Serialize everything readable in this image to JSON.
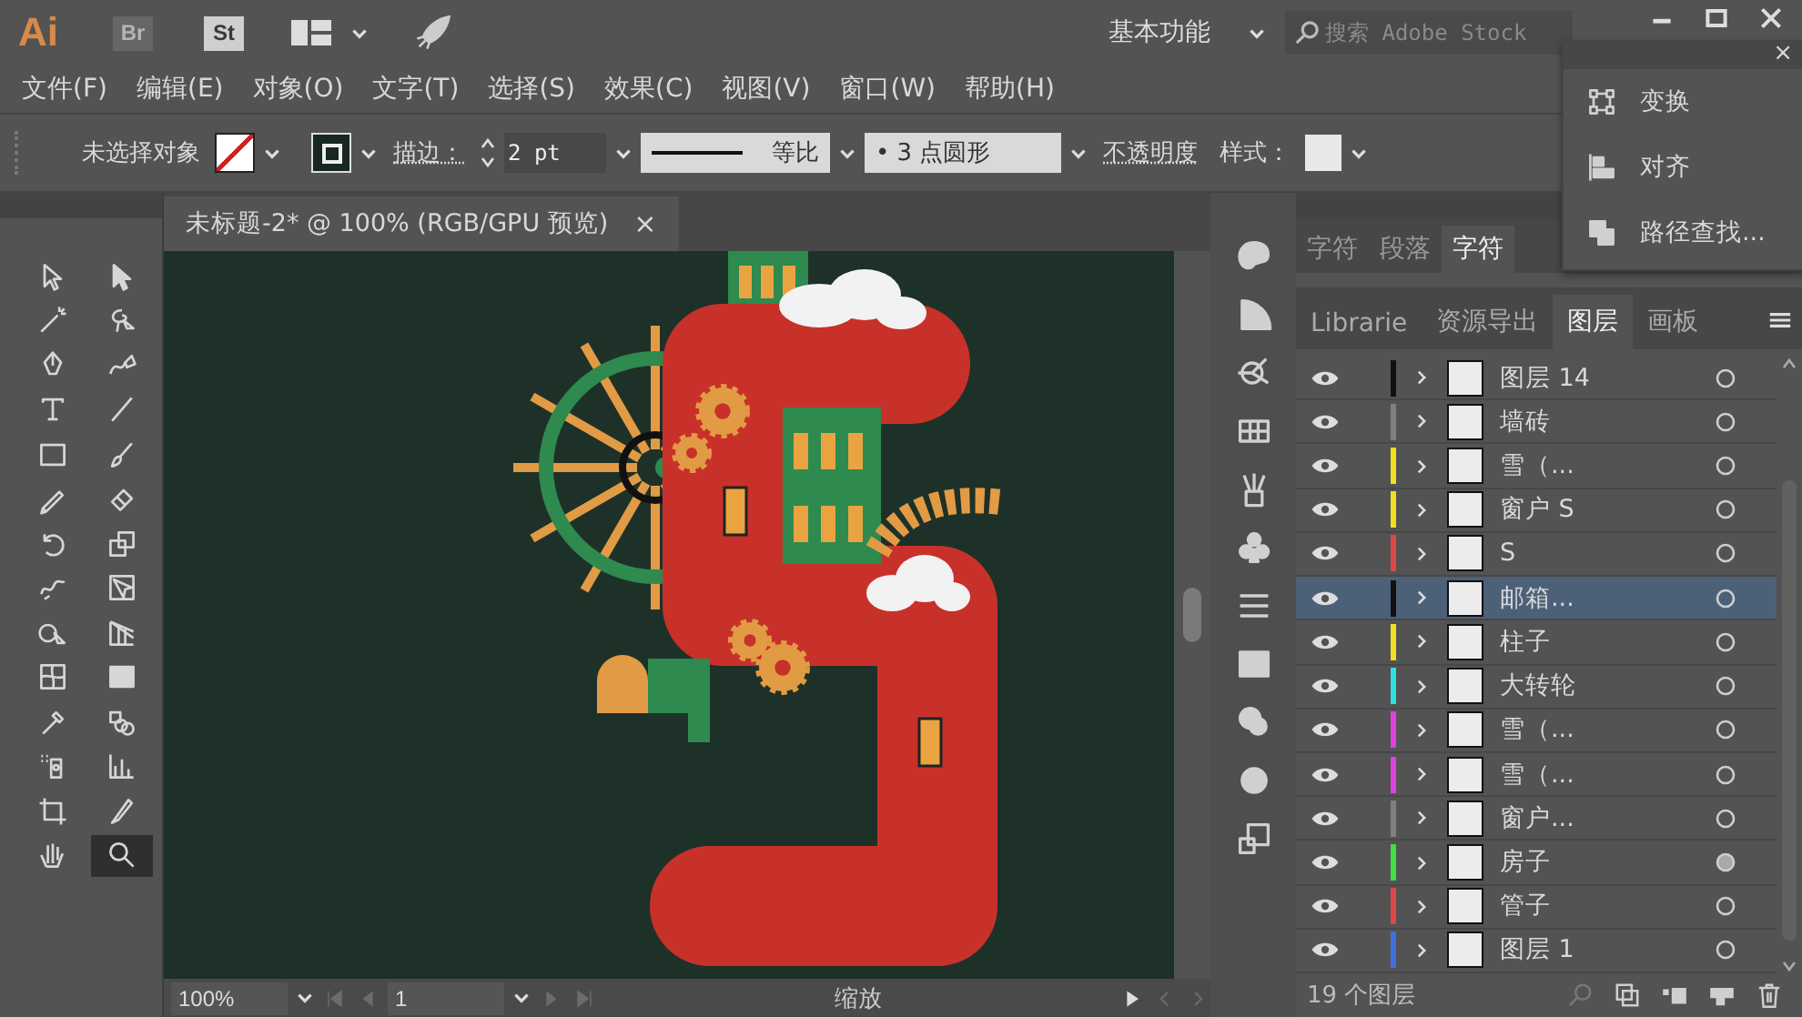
{
  "app_bar": {
    "logo": "Ai",
    "bridge_button": "Br",
    "stock_button": "St",
    "workspace": "基本功能",
    "search": {
      "placeholder": "搜索 Adobe Stock"
    }
  },
  "menu_bar": [
    "文件(F)",
    "编辑(E)",
    "对象(O)",
    "文字(T)",
    "选择(S)",
    "效果(C)",
    "视图(V)",
    "窗口(W)",
    "帮助(H)"
  ],
  "control_bar": {
    "selection": "未选择对象",
    "stroke_label": "描边：",
    "stroke_weight": "2 pt",
    "stroke_profile": "等比",
    "brush": "• 3 点圆形",
    "opacity_label": "不透明度",
    "style_label": "样式："
  },
  "tools": [
    {
      "selected": false
    },
    {
      "selected": false
    },
    {
      "selected": false
    },
    {
      "selected": false
    },
    {
      "selected": false
    },
    {
      "selected": false
    },
    {
      "selected": false
    },
    {
      "selected": false
    },
    {
      "selected": false
    },
    {
      "selected": false
    },
    {
      "selected": false
    },
    {
      "selected": false
    },
    {
      "selected": false
    },
    {
      "selected": false
    },
    {
      "selected": false
    },
    {
      "selected": false
    },
    {
      "selected": false
    },
    {
      "selected": false
    },
    {
      "selected": false
    },
    {
      "selected": false
    },
    {
      "selected": false
    },
    {
      "selected": false
    },
    {
      "selected": false
    },
    {
      "selected": false
    },
    {
      "selected": false
    },
    {
      "selected": false
    },
    {
      "selected": false
    },
    {
      "selected": true
    }
  ],
  "document_tab": {
    "title": "未标题-2* @ 100% (RGB/GPU 预览)",
    "close": "×"
  },
  "floating_panel": {
    "close": "×",
    "items": [
      "变换",
      "对齐",
      "路径查找..."
    ]
  },
  "type_tabs": [
    {
      "label": "字符",
      "selected": false
    },
    {
      "label": "段落",
      "selected": false
    },
    {
      "label": "字符",
      "selected": true
    }
  ],
  "layers_panel": {
    "tabs": [
      {
        "label": "Librarie",
        "selected": false
      },
      {
        "label": "资源导出",
        "selected": false
      },
      {
        "label": "图层",
        "selected": true
      },
      {
        "label": "画板",
        "selected": false
      }
    ],
    "layers": [
      {
        "name": "图层 14",
        "color": "#111111",
        "selected": false,
        "targeted": false
      },
      {
        "name": "墙砖",
        "color": "#808080",
        "selected": false,
        "targeted": false
      },
      {
        "name": "雪（...",
        "color": "#f0e020",
        "selected": false,
        "targeted": false
      },
      {
        "name": "窗户 S",
        "color": "#f0e020",
        "selected": false,
        "targeted": false
      },
      {
        "name": "S",
        "color": "#e04848",
        "selected": false,
        "targeted": false
      },
      {
        "name": "邮箱...",
        "color": "#111111",
        "selected": true,
        "targeted": false
      },
      {
        "name": "柱子",
        "color": "#f0e020",
        "selected": false,
        "targeted": false
      },
      {
        "name": "大转轮",
        "color": "#30e0e0",
        "selected": false,
        "targeted": false
      },
      {
        "name": "雪（...",
        "color": "#e040e0",
        "selected": false,
        "targeted": false
      },
      {
        "name": "雪（...",
        "color": "#e040e0",
        "selected": false,
        "targeted": false
      },
      {
        "name": "窗户...",
        "color": "#808080",
        "selected": false,
        "targeted": false
      },
      {
        "name": "房子",
        "color": "#40e040",
        "selected": false,
        "targeted": true
      },
      {
        "name": "管子",
        "color": "#e04848",
        "selected": false,
        "targeted": false
      },
      {
        "name": "图层 1",
        "color": "#4070e0",
        "selected": false,
        "targeted": false
      }
    ],
    "footer": "19 个图层"
  },
  "status_bar": {
    "zoom": "100%",
    "artboard": "1",
    "tool": "缩放"
  }
}
